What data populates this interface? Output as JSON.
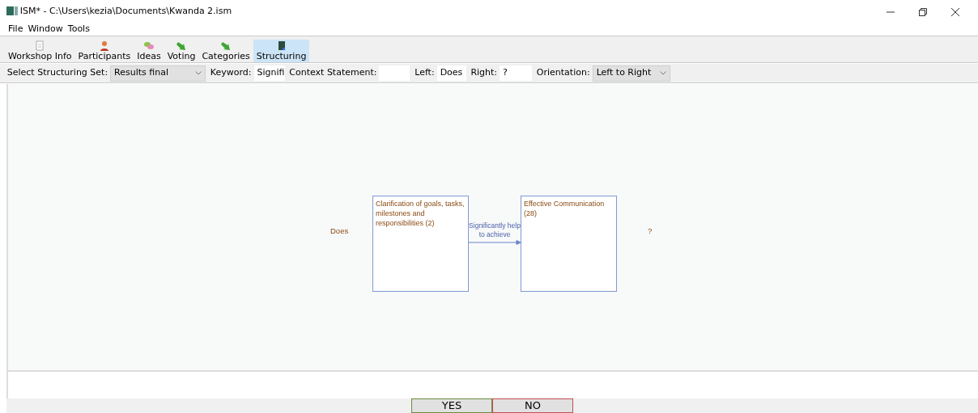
{
  "window": {
    "title": "ISM* - C:\\Users\\kezia\\Documents\\Kwanda 2.ism"
  },
  "menu": [
    "File",
    "Window",
    "Tools"
  ],
  "tabs": [
    {
      "label": "Workshop Info",
      "kind": "doc",
      "selected": false
    },
    {
      "label": "Participants",
      "kind": "person",
      "selected": false
    },
    {
      "label": "Ideas",
      "kind": "bubbles",
      "selected": false
    },
    {
      "label": "Voting",
      "kind": "arrow",
      "selected": false
    },
    {
      "label": "Categories",
      "kind": "arrow",
      "selected": false
    },
    {
      "label": "Structuring",
      "kind": "book",
      "selected": true
    }
  ],
  "options": {
    "set_label": "Select Structuring Set:",
    "set_value": "Results final",
    "keyword_label": "Keyword:",
    "keyword_value": "Signifi",
    "context_label": "Context Statement:",
    "left_label": "Left:",
    "left_value": "Does",
    "right_label": "Right:",
    "right_value": "?",
    "orientation_label": "Orientation:",
    "orientation_value": "Left to Right"
  },
  "diagram": {
    "left_word": "Does",
    "from": "Clarification of goals, tasks, milestones and responsibilities (2)",
    "relation": "Significantly help to achieve",
    "to": "Effective Communication  (28)",
    "right_word": "?"
  },
  "buttons": [
    "YES",
    "NO"
  ]
}
